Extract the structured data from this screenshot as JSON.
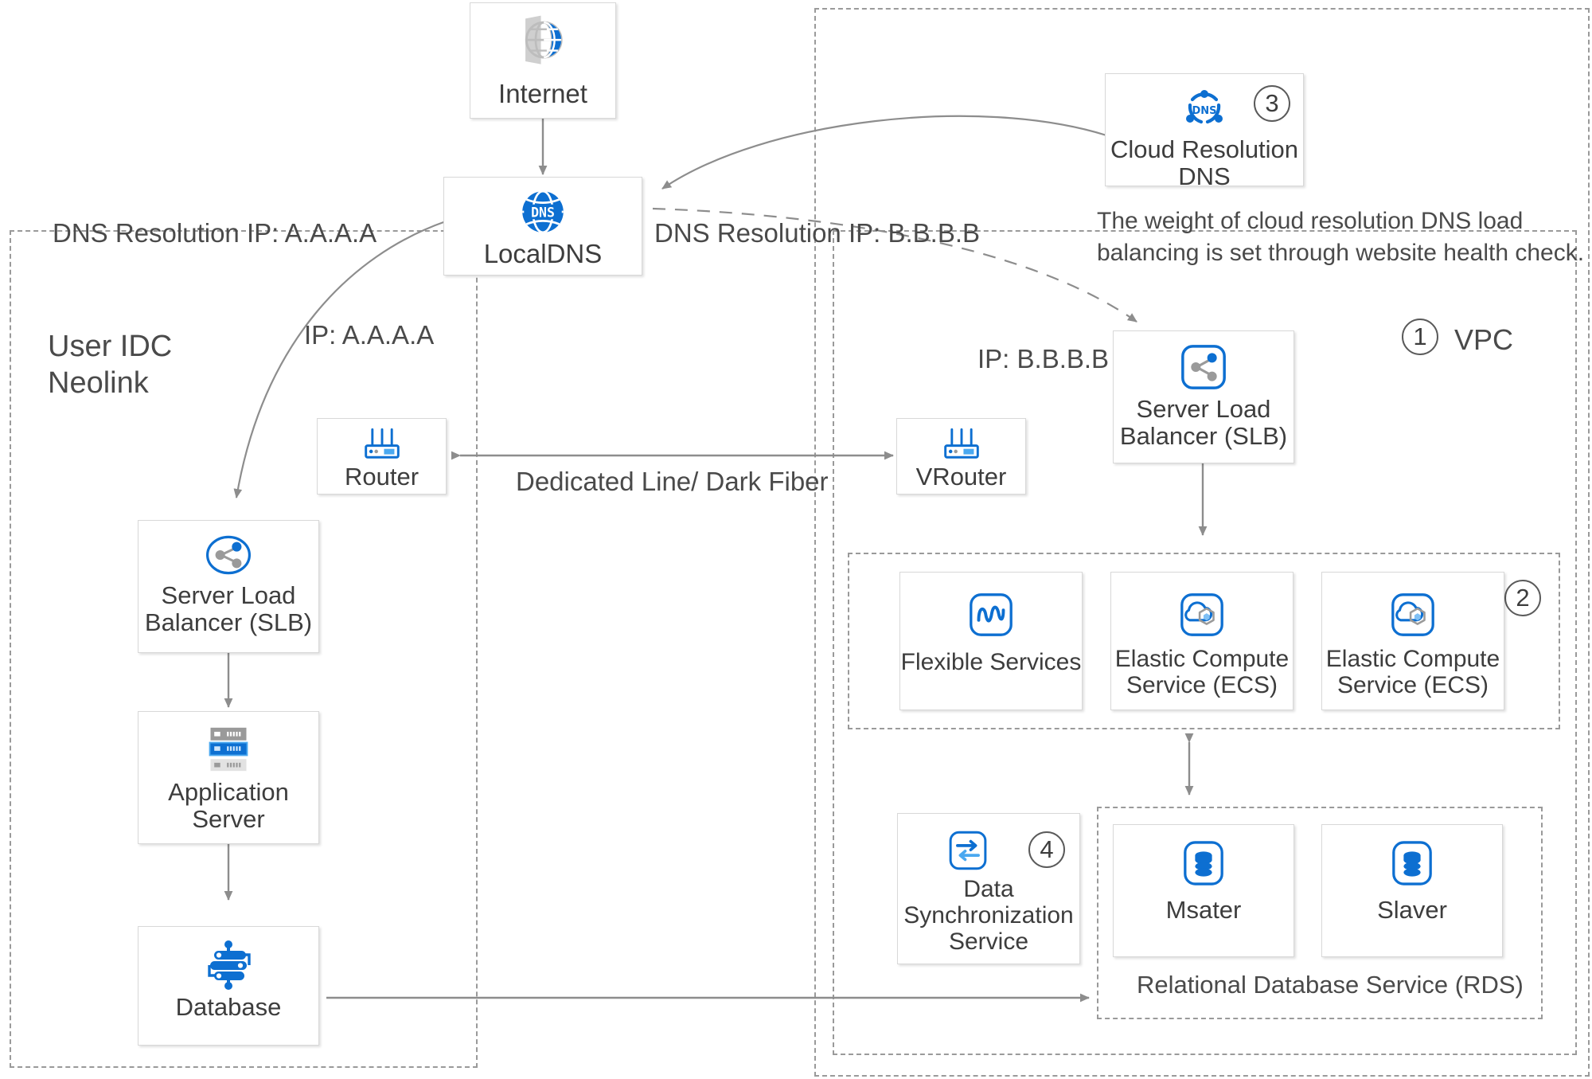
{
  "diagram": {
    "title": "Hybrid Cloud Architecture – User IDC to VPC",
    "accent_blue": "#0d6fd1",
    "light_blue": "#4aa8f0",
    "grey": "#9a9a9a",
    "text_grey": "#4a4a4a"
  },
  "zones": [
    {
      "name": "user-idc",
      "label": "User IDC\nNeolink"
    },
    {
      "name": "cloud-outer",
      "label": ""
    },
    {
      "name": "vpc",
      "label": "VPC",
      "badge": "1"
    },
    {
      "name": "ecs-group",
      "label": "",
      "badge": "2"
    },
    {
      "name": "rds-group",
      "label": "Relational Database Service (RDS)"
    }
  ],
  "nodes": {
    "internet": {
      "label": "Internet",
      "icon": "internet-globe-icon"
    },
    "localdns": {
      "label": "LocalDNS",
      "icon": "dns-globe-icon"
    },
    "cloud_dns": {
      "label": "Cloud Resolution\nDNS",
      "icon": "cloud-dns-icon",
      "badge": "3"
    },
    "router": {
      "label": "Router",
      "icon": "router-icon"
    },
    "vrouter": {
      "label": "VRouter",
      "icon": "router-icon"
    },
    "idc_slb": {
      "label": "Server Load\nBalancer (SLB)",
      "icon": "load-balancer-circle-icon"
    },
    "vpc_slb": {
      "label": "Server Load\nBalancer (SLB)",
      "icon": "load-balancer-square-icon"
    },
    "app_server": {
      "label": "Application\nServer",
      "icon": "server-stack-icon"
    },
    "database": {
      "label": "Database",
      "icon": "database-nodes-icon"
    },
    "flexible": {
      "label": "Flexible Services",
      "icon": "flexible-services-icon"
    },
    "ecs_1": {
      "label": "Elastic Compute\nService (ECS)",
      "icon": "ecs-cloud-icon"
    },
    "ecs_2": {
      "label": "Elastic Compute\nService (ECS)",
      "icon": "ecs-cloud-icon"
    },
    "dts": {
      "label": "Data\nSynchronization\nService",
      "icon": "data-sync-icon",
      "badge": "4"
    },
    "rds_master": {
      "label": "Msater",
      "icon": "database-cylinder-icon"
    },
    "rds_slave": {
      "label": "Slaver",
      "icon": "database-cylinder-icon"
    }
  },
  "annotations": {
    "dns_ip_a": "DNS Resolution IP: A.A.A.A",
    "dns_ip_b": "DNS Resolution IP: B.B.B.B",
    "ip_a": "IP: A.A.A.A",
    "ip_b": "IP: B.B.B.B",
    "link_label": "Dedicated Line/ Dark Fiber",
    "health_note": "The weight of cloud resolution DNS load\nbalancing is set through website health check.",
    "vpc_label": "VPC",
    "rds_label": "Relational Database Service (RDS)",
    "idc_label": "User IDC\nNeolink"
  },
  "badges": {
    "vpc": "1",
    "ecs": "2",
    "cloud_dns": "3",
    "dts": "4"
  }
}
